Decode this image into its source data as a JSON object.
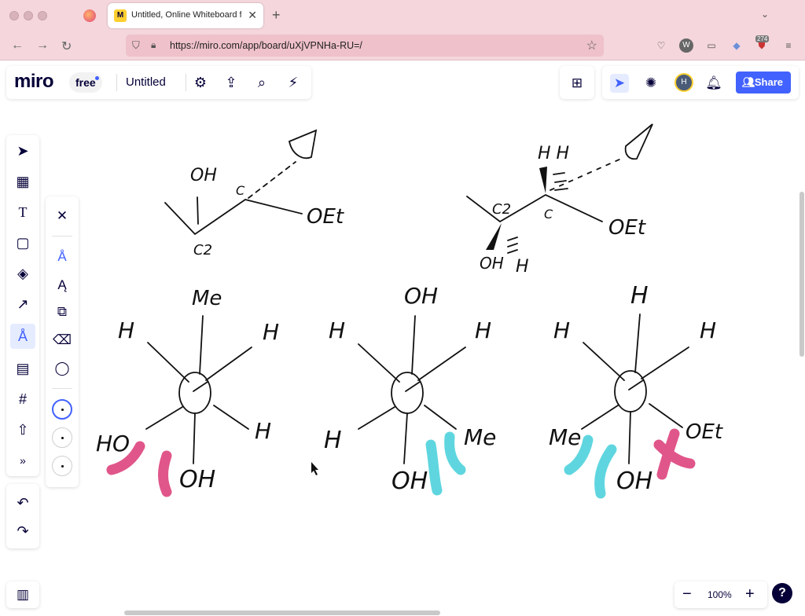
{
  "browser": {
    "active_tab_title": "Untitled, Online Whiteboard for",
    "url": "https://miro.com/app/board/uXjVPNHa-RU=/",
    "extension_badge": "274",
    "extension_w": "W"
  },
  "app": {
    "logo": "miro",
    "plan": "free",
    "board_name": "Untitled",
    "share_label": "Share",
    "avatar_initial": "H",
    "zoom_level": "100%",
    "help": "?"
  },
  "icons": {
    "settings": "gear-icon",
    "export": "upload-icon",
    "search": "search-icon",
    "plugin": "plug-icon",
    "apps": "grid-plus-icon",
    "select": "cursor-icon",
    "reactions": "party-icon",
    "notifications": "bell-icon"
  },
  "toolbar": {
    "tools": [
      "select",
      "templates",
      "text",
      "sticky-note",
      "shapes",
      "connection-line",
      "pen",
      "comment",
      "frame",
      "upload",
      "more"
    ]
  },
  "drawing": {
    "labels": {
      "oh_top": "OH",
      "c1": "C",
      "c2": "C2",
      "oet_top_left": "OEt",
      "hh": "H H",
      "c2_right": "C2",
      "c1_right": "C",
      "oet_top_right": "OEt",
      "oh_wedge": "OH",
      "h_hash": "H",
      "n1_top": "Me",
      "n1_ul": "H",
      "n1_ur": "H",
      "n1_ll": "HO",
      "n1_lr": "H",
      "n1_bottom": "OH",
      "n2_top": "OH",
      "n2_ul": "H",
      "n2_ur": "H",
      "n2_ll": "H",
      "n2_lr": "Me",
      "n2_bottom": "OH",
      "n3_top": "H",
      "n3_ul": "H",
      "n3_ur": "H",
      "n3_ll": "Me",
      "n3_lr": "OEt",
      "n3_bottom": "OH"
    },
    "highlight_colors": {
      "pink": "#e0568a",
      "cyan": "#5fd6df"
    }
  }
}
